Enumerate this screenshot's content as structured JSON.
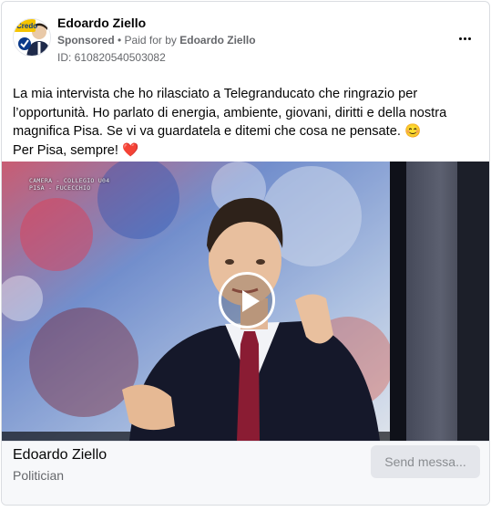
{
  "advertiser": {
    "name": "Edoardo Ziello",
    "sponsored_label": "Sponsored",
    "paid_for_prefix": " • Paid for by ",
    "paid_for_name": "Edoardo Ziello",
    "ad_id": "ID: 610820540503082",
    "avatar_badge_text": "Credo"
  },
  "post": {
    "line1": "La mia intervista che ho rilasciato a Telegranducato che ringrazio per l’opportunità. Ho parlato di energia, ambiente, giovani, diritti e della nostra magnifica Pisa. Se vi va guardatela e ditemi che cosa ne pensate. 😊",
    "line2": "Per Pisa, sempre! ❤️"
  },
  "video": {
    "caption_line1": "CAMERA - COLLEGIO U04",
    "caption_line2": "PISA - FUCECCHIO"
  },
  "footer": {
    "page_name": "Edoardo Ziello",
    "page_category": "Politician",
    "send_button_label": "Send messa..."
  },
  "colors": {
    "secondary_text": "#65676b",
    "button_bg": "#e4e6eb",
    "heart": "#e41e3f",
    "tie": "#8a1c33"
  }
}
